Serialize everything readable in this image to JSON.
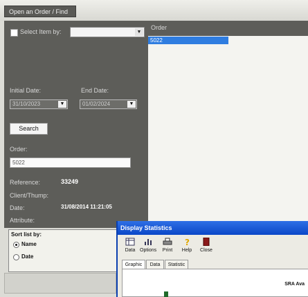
{
  "window": {
    "title": "Open an Order / Find"
  },
  "filters": {
    "select_item_by_label": "Select Item by:",
    "select_item_by_value": "",
    "initial_date_label": "Initial Date:",
    "initial_date_value": "31/10/2023",
    "end_date_label": "End Date:",
    "end_date_value": "01/02/2024",
    "search_label": "Search",
    "order_label": "Order:",
    "order_value": "5022"
  },
  "details": {
    "reference_label": "Reference:",
    "reference_value": "33249",
    "client_label": "Client/Thump:",
    "date_label": "Date:",
    "date_value": "31/08/2014 11:21:05",
    "attribute_label": "Attribute:"
  },
  "order_list": {
    "header": "Order",
    "items": [
      "5022"
    ]
  },
  "sort": {
    "title": "Sort list by:",
    "options": [
      {
        "label": "Name",
        "selected": true
      },
      {
        "label": "Date",
        "selected": false
      }
    ]
  },
  "dialog": {
    "title": "Display Statistics",
    "toolbar": [
      {
        "label": "Data",
        "icon": "table-icon"
      },
      {
        "label": "Options",
        "icon": "options-icon"
      },
      {
        "label": "Print",
        "icon": "printer-icon"
      },
      {
        "label": "Help",
        "icon": "help-icon"
      },
      {
        "label": "Close",
        "icon": "close-icon"
      }
    ],
    "tabs": [
      "Graphic",
      "Data",
      "Statistic"
    ],
    "content_label": "SRA Ava"
  },
  "colors": {
    "panel": "#5d5d59",
    "selection": "#2f7de0",
    "dialog_title": "#0a47c8"
  }
}
